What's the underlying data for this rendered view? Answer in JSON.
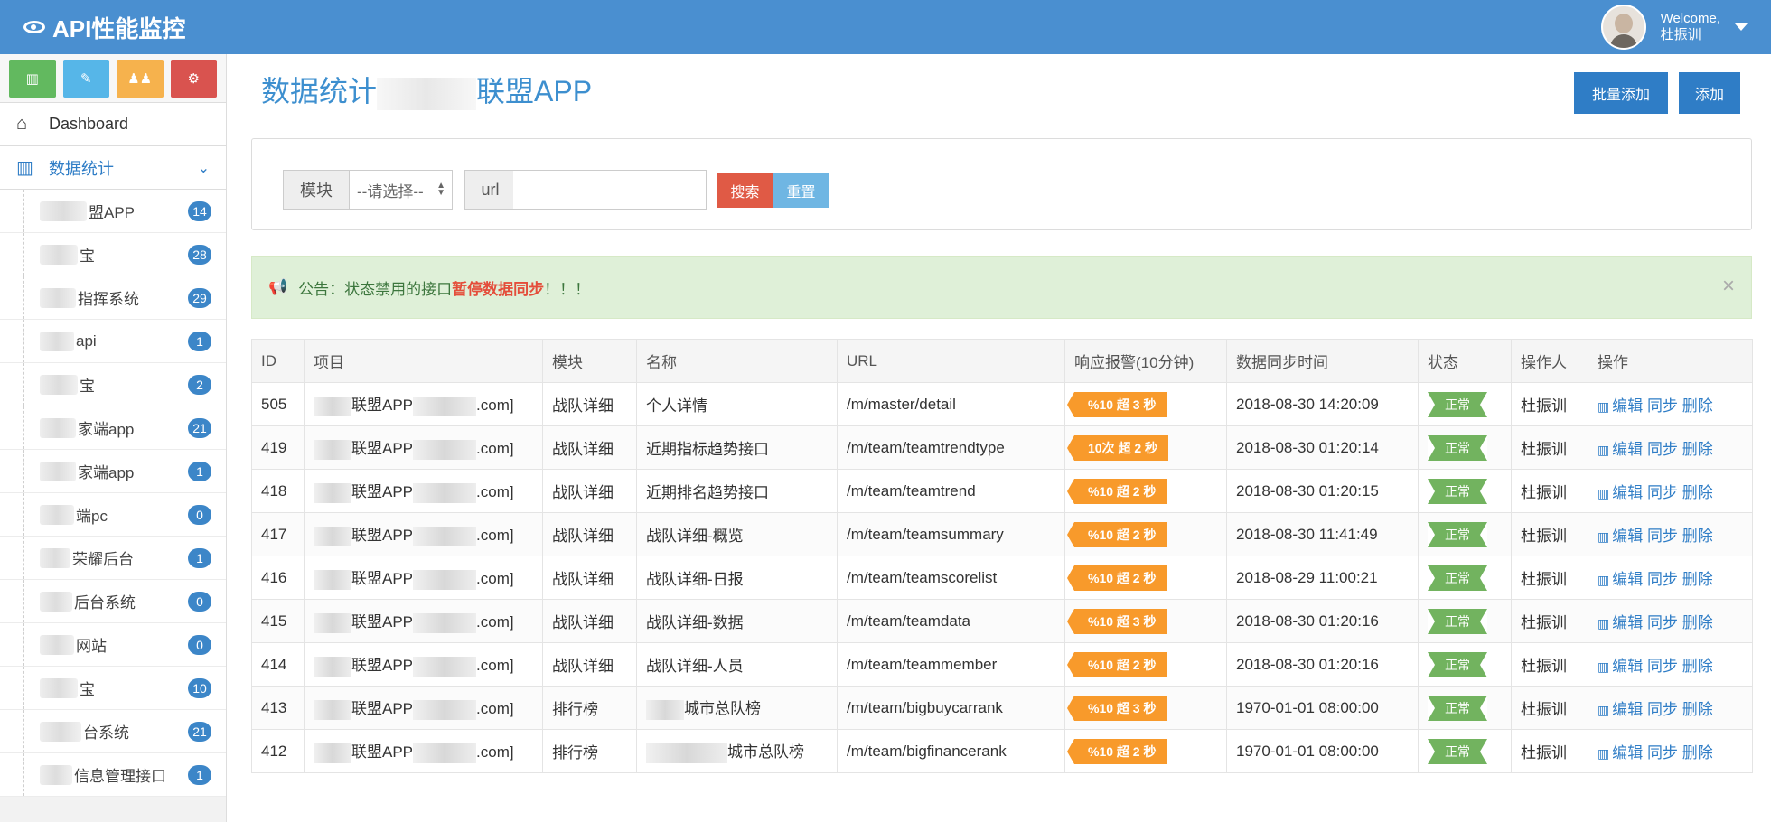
{
  "app": {
    "title": "API性能监控"
  },
  "user": {
    "welcome": "Welcome,",
    "name": "杜振训"
  },
  "quick_buttons": [
    {
      "icon": "signal-icon",
      "color": "#62b95f"
    },
    {
      "icon": "pencil-icon",
      "color": "#56b6e8"
    },
    {
      "icon": "users-icon",
      "color": "#f6b24d"
    },
    {
      "icon": "gears-icon",
      "color": "#d9534f"
    }
  ],
  "menu": {
    "dashboard": "Dashboard",
    "stats": "数据统计",
    "sub_items": [
      {
        "label": "盟APP",
        "count": "14"
      },
      {
        "label": "宝",
        "count": "28"
      },
      {
        "label": "指挥系统",
        "count": "29"
      },
      {
        "label": "api",
        "count": "1"
      },
      {
        "label": "宝",
        "count": "2"
      },
      {
        "label": "家端app",
        "count": "21"
      },
      {
        "label": "家端app",
        "count": "1"
      },
      {
        "label": "端pc",
        "count": "0"
      },
      {
        "label": "荣耀后台",
        "count": "1"
      },
      {
        "label": "后台系统",
        "count": "0"
      },
      {
        "label": "网站",
        "count": "0"
      },
      {
        "label": "宝",
        "count": "10"
      },
      {
        "label": "台系统",
        "count": "21"
      },
      {
        "label": "信息管理接口",
        "count": "1"
      }
    ]
  },
  "page": {
    "title_prefix": "数据统计",
    "title_suffix": "联盟APP"
  },
  "toolbar": {
    "batch_add": "批量添加",
    "add": "添加"
  },
  "search": {
    "module_label": "模块",
    "module_value": "--请选择--",
    "url_label": "url",
    "url_placeholder": "",
    "search_button": "搜索",
    "reset_button": "重置"
  },
  "notice": {
    "prefix": "公告：状态禁用的接口",
    "strong": "暂停数据同步",
    "suffix": "！！！"
  },
  "table": {
    "headers": [
      "ID",
      "项目",
      "模块",
      "名称",
      "URL",
      "响应报警(10分钟)",
      "数据同步时间",
      "状态",
      "操作人",
      "操作"
    ],
    "ops": {
      "edit": "编辑",
      "sync": "同步",
      "delete": "删除"
    },
    "rows": [
      {
        "id": "505",
        "project": "联盟APP",
        "project_suffix": ".com]",
        "module": "战队详细",
        "name": "个人详情",
        "url": "/m/master/detail",
        "alert": "%10 超 3 秒",
        "sync_time": "2018-08-30 14:20:09",
        "status": "正常",
        "operator": "杜振训"
      },
      {
        "id": "419",
        "project": "联盟APP",
        "project_suffix": ".com]",
        "module": "战队详细",
        "name": "近期指标趋势接口",
        "url": "/m/team/teamtrendtype",
        "alert": "10次 超 2 秒",
        "sync_time": "2018-08-30 01:20:14",
        "status": "正常",
        "operator": "杜振训"
      },
      {
        "id": "418",
        "project": "联盟APP",
        "project_suffix": ".com]",
        "module": "战队详细",
        "name": "近期排名趋势接口",
        "url": "/m/team/teamtrend",
        "alert": "%10 超 2 秒",
        "sync_time": "2018-08-30 01:20:15",
        "status": "正常",
        "operator": "杜振训"
      },
      {
        "id": "417",
        "project": "联盟APP",
        "project_suffix": ".com]",
        "module": "战队详细",
        "name": "战队详细-概览",
        "url": "/m/team/teamsummary",
        "alert": "%10 超 2 秒",
        "sync_time": "2018-08-30 11:41:49",
        "status": "正常",
        "operator": "杜振训"
      },
      {
        "id": "416",
        "project": "联盟APP",
        "project_suffix": ".com]",
        "module": "战队详细",
        "name": "战队详细-日报",
        "url": "/m/team/teamscorelist",
        "alert": "%10 超 2 秒",
        "sync_time": "2018-08-29 11:00:21",
        "status": "正常",
        "operator": "杜振训"
      },
      {
        "id": "415",
        "project": "联盟APP",
        "project_suffix": ".com]",
        "module": "战队详细",
        "name": "战队详细-数据",
        "url": "/m/team/teamdata",
        "alert": "%10 超 3 秒",
        "sync_time": "2018-08-30 01:20:16",
        "status": "正常",
        "operator": "杜振训"
      },
      {
        "id": "414",
        "project": "联盟APP",
        "project_suffix": ".com]",
        "module": "战队详细",
        "name": "战队详细-人员",
        "url": "/m/team/teammember",
        "alert": "%10 超 2 秒",
        "sync_time": "2018-08-30 01:20:16",
        "status": "正常",
        "operator": "杜振训"
      },
      {
        "id": "413",
        "project": "联盟APP",
        "project_suffix": ".com]",
        "module": "排行榜",
        "name": "城市总队榜",
        "url": "/m/team/bigbuycarrank",
        "alert": "%10 超 3 秒",
        "sync_time": "1970-01-01 08:00:00",
        "status": "正常",
        "operator": "杜振训"
      },
      {
        "id": "412",
        "project": "联盟APP",
        "project_suffix": ".com]",
        "module": "排行榜",
        "name": "城市总队榜",
        "url": "/m/team/bigfinancerank",
        "alert": "%10 超 2 秒",
        "sync_time": "1970-01-01 08:00:00",
        "status": "正常",
        "operator": "杜振训"
      }
    ]
  }
}
